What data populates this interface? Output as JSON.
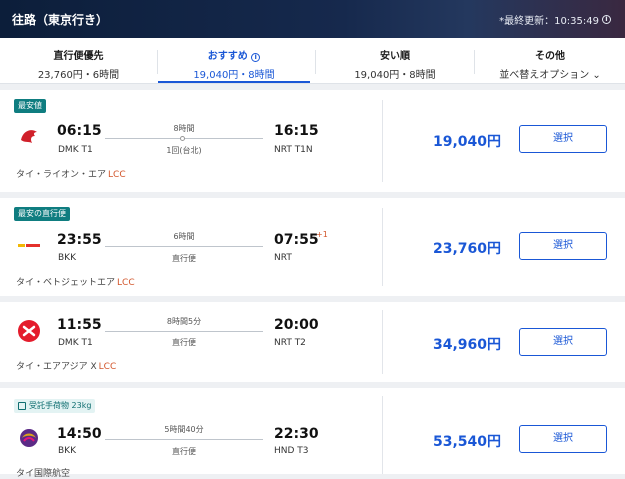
{
  "header": {
    "title": "往路（東京行き）",
    "updated": "*最終更新：10:35:49"
  },
  "tabs": [
    {
      "label": "直行便優先",
      "sub": "23,760円・6時間"
    },
    {
      "label": "おすすめ",
      "sub": "19,040円・8時間",
      "active": true
    },
    {
      "label": "安い順",
      "sub": "19,040円・8時間"
    },
    {
      "label": "その他",
      "sub": "並べ替えオプション"
    }
  ],
  "flights": [
    {
      "badge": "最安値",
      "dep_time": "06:15",
      "dep_code": "DMK T1",
      "arr_time": "16:15",
      "arr_code": "NRT T1N",
      "duration": "8時間",
      "via": "1回(台北)",
      "airline": "タイ・ライオン・エア",
      "lcc": "LCC",
      "price": "19,040円",
      "select": "選択"
    },
    {
      "badge": "最安の直行便",
      "dep_time": "23:55",
      "dep_code": "BKK",
      "arr_time": "07:55",
      "arr_plus": "+1",
      "arr_code": "NRT",
      "duration": "6時間",
      "via": "直行便",
      "airline": "タイ・ベトジェットエア",
      "lcc": "LCC",
      "price": "23,760円",
      "select": "選択"
    },
    {
      "dep_time": "11:55",
      "dep_code": "DMK T1",
      "arr_time": "20:00",
      "arr_code": "NRT T2",
      "duration": "8時間5分",
      "via": "直行便",
      "airline": "タイ・エアアジア X",
      "lcc": "LCC",
      "price": "34,960円",
      "select": "選択"
    },
    {
      "badge": "受託手荷物 23kg",
      "dep_time": "14:50",
      "dep_code": "BKK",
      "arr_time": "22:30",
      "arr_code": "HND T3",
      "duration": "5時間40分",
      "via": "直行便",
      "airline": "タイ国際航空",
      "price": "53,540円",
      "select": "選択"
    }
  ],
  "colors": {
    "accent": "#1a57d6",
    "badge": "#0f7d80",
    "lcc": "#d2552b"
  }
}
